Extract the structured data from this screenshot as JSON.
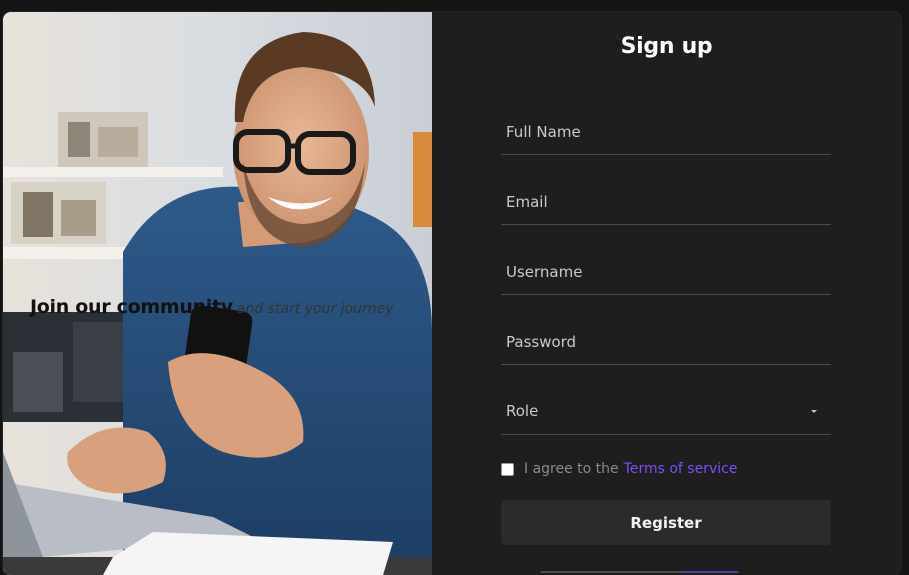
{
  "hero": {
    "heading": "Join our community",
    "subheading": "and start your journey"
  },
  "form": {
    "title": "Sign up",
    "fields": {
      "full_name": {
        "placeholder": "Full Name",
        "value": ""
      },
      "email": {
        "placeholder": "Email",
        "value": ""
      },
      "username": {
        "placeholder": "Username",
        "value": ""
      },
      "password": {
        "placeholder": "Password",
        "value": ""
      }
    },
    "role": {
      "label": "Role"
    },
    "terms": {
      "checked": false,
      "text": "I agree to the",
      "link_text": "Terms of service"
    },
    "register_label": "Register"
  },
  "colors": {
    "background": "#1e1e1e",
    "accent": "#7c4dff",
    "button": "#2b2b2b"
  }
}
